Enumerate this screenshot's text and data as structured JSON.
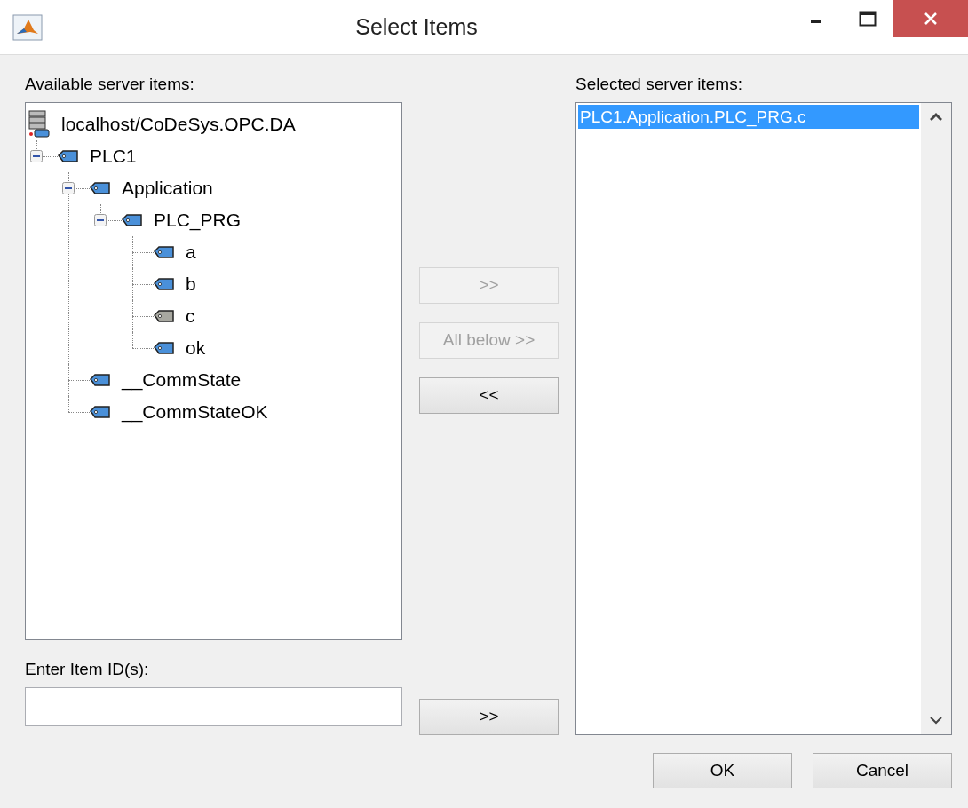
{
  "window": {
    "title": "Select Items"
  },
  "available": {
    "label": "Available server items:",
    "tree": [
      {
        "kind": "server",
        "label": "localhost/CoDeSys.OPC.DA",
        "children": [
          {
            "kind": "tag",
            "label": "PLC1",
            "greyed": false,
            "expanded": true,
            "children": [
              {
                "kind": "tag",
                "label": "Application",
                "greyed": false,
                "expanded": true,
                "children": [
                  {
                    "kind": "tag",
                    "label": "PLC_PRG",
                    "greyed": false,
                    "expanded": true,
                    "children": [
                      {
                        "kind": "tag",
                        "label": "a",
                        "greyed": false
                      },
                      {
                        "kind": "tag",
                        "label": "b",
                        "greyed": false
                      },
                      {
                        "kind": "tag",
                        "label": "c",
                        "greyed": true
                      },
                      {
                        "kind": "tag",
                        "label": "ok",
                        "greyed": false
                      }
                    ]
                  }
                ]
              },
              {
                "kind": "tag",
                "label": "__CommState",
                "greyed": false
              },
              {
                "kind": "tag",
                "label": "__CommStateOK",
                "greyed": false
              }
            ]
          }
        ]
      }
    ]
  },
  "transfer_buttons": [
    {
      "label": ">>",
      "disabled": true
    },
    {
      "label": "All below >>",
      "disabled": true
    },
    {
      "label": "<<",
      "disabled": false
    }
  ],
  "id_entry": {
    "label": "Enter Item ID(s):",
    "button": {
      "label": ">>",
      "disabled": false
    }
  },
  "selected": {
    "label": "Selected server items:",
    "items": [
      {
        "text": "PLC1.Application.PLC_PRG.c",
        "selected": true
      }
    ]
  },
  "footer_buttons": [
    "OK",
    "Cancel"
  ]
}
